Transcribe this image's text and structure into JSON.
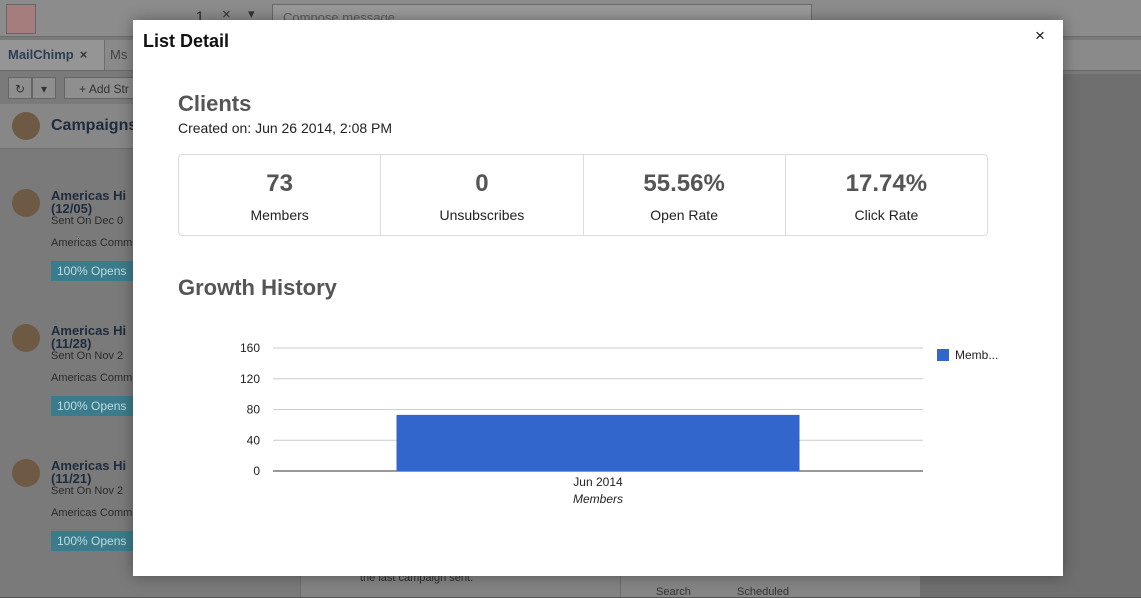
{
  "background": {
    "topbar": {
      "count": "1",
      "clear_icon": "×",
      "compose_placeholder": "Compose message..."
    },
    "tabs": [
      {
        "label": "MailChimp",
        "close": "×"
      },
      {
        "label": "Ms"
      }
    ],
    "toolbar": {
      "add_label": "+ Add Str"
    },
    "panel_header": "Campaigns",
    "items": [
      {
        "title": "Americas Hi",
        "date": "(12/05)",
        "sent": "Sent On Dec 0",
        "list": "Americas Comm",
        "badge": "100% Opens"
      },
      {
        "title": "Americas Hi",
        "date": "(11/28)",
        "sent": "Sent On Nov 2",
        "list": "Americas Comm",
        "badge": "100% Opens"
      },
      {
        "title": "Americas Hi",
        "date": "(11/21)",
        "sent": "Sent On Nov 2",
        "list": "Americas Comm",
        "badge": "100% Opens"
      }
    ],
    "mid_text": "the last campaign sent.",
    "search_label": "Search",
    "scheduled_label": "Scheduled"
  },
  "modal": {
    "title": "List Detail",
    "close_icon": "×",
    "list_name": "Clients",
    "created_label": "Created on:",
    "created_value": "Jun 26 2014, 2:08 PM",
    "stats": [
      {
        "value": "73",
        "label": "Members"
      },
      {
        "value": "0",
        "label": "Unsubscribes"
      },
      {
        "value": "55.56%",
        "label": "Open Rate"
      },
      {
        "value": "17.74%",
        "label": "Click Rate"
      }
    ],
    "section_title": "Growth History"
  },
  "chart_data": {
    "type": "bar",
    "categories": [
      "Jun 2014"
    ],
    "series": [
      {
        "name": "Memb...",
        "values": [
          73
        ],
        "color": "#3366cc"
      }
    ],
    "xlabel": "Members",
    "ylabel": "",
    "ylim": [
      0,
      160
    ],
    "yticks": [
      0,
      40,
      80,
      120,
      160
    ],
    "grid": true,
    "legend": "right"
  }
}
